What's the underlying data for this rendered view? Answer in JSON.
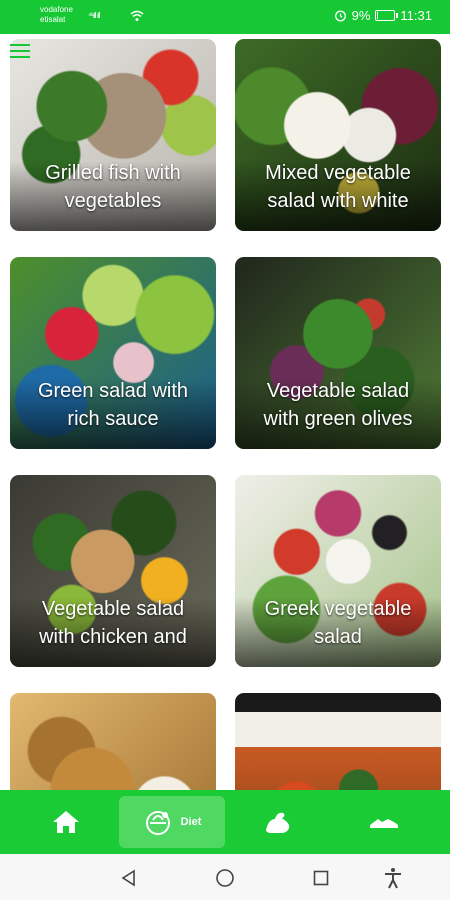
{
  "status_bar": {
    "carrier_1": "vodafone",
    "carrier_2": "etisalat",
    "signal_text": "⁴⁶ıll ıll",
    "battery_percent": "9%",
    "battery_level": 0.09,
    "time": "11:31"
  },
  "recipes": [
    {
      "title_line1": "Grilled fish with",
      "title_line2": "vegetables"
    },
    {
      "title_line1": "Mixed vegetable",
      "title_line2": "salad with white"
    },
    {
      "title_line1": "Green salad with",
      "title_line2": "rich sauce"
    },
    {
      "title_line1": "Vegetable salad",
      "title_line2": "with green olives"
    },
    {
      "title_line1": "Vegetable salad",
      "title_line2": "with chicken and"
    },
    {
      "title_line1": "Greek vegetable",
      "title_line2": "salad"
    },
    {
      "title_line1": "",
      "title_line2": ""
    },
    {
      "title_line1": "",
      "title_line2": ""
    }
  ],
  "bottom_nav": {
    "items": [
      {
        "icon": "home-icon",
        "label": ""
      },
      {
        "icon": "diet-bowl-icon",
        "label": "Diet"
      },
      {
        "icon": "muscle-arm-icon",
        "label": ""
      },
      {
        "icon": "sneaker-icon",
        "label": ""
      }
    ],
    "active_index": 1
  },
  "colors": {
    "accent": "#16c834",
    "nav_background": "#1bcb35",
    "nav_active": "#4fd862",
    "system_bar": "#f7f7f7"
  }
}
